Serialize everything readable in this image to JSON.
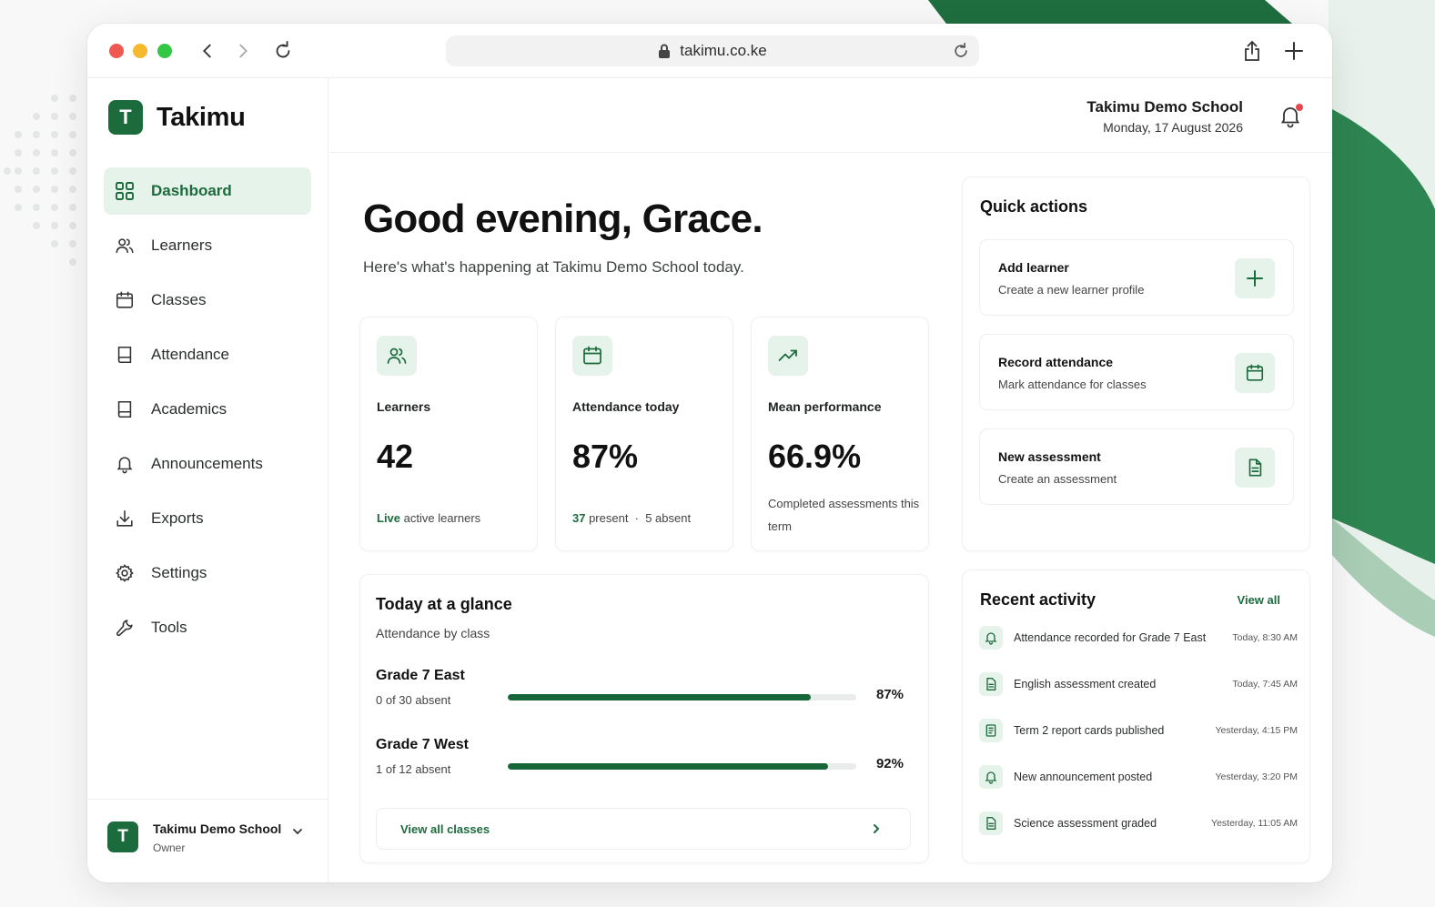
{
  "browser": {
    "url": "takimu.co.ke"
  },
  "brand": {
    "logo_letter": "T",
    "name": "Takimu",
    "accent": "#1c6b3d"
  },
  "nav": {
    "items": [
      {
        "label": "Dashboard",
        "icon": "grid-icon",
        "active": true
      },
      {
        "label": "Learners",
        "icon": "users-icon"
      },
      {
        "label": "Classes",
        "icon": "calendar-icon"
      },
      {
        "label": "Attendance",
        "icon": "book-icon"
      },
      {
        "label": "Academics",
        "icon": "book-icon"
      },
      {
        "label": "Announcements",
        "icon": "bell-icon"
      },
      {
        "label": "Exports",
        "icon": "download-icon"
      },
      {
        "label": "Settings",
        "icon": "gear-icon"
      },
      {
        "label": "Tools",
        "icon": "wrench-icon"
      }
    ]
  },
  "account": {
    "logo_letter": "T",
    "school": "Takimu Demo School",
    "role": "Owner"
  },
  "header": {
    "school": "Takimu Demo School",
    "date": "Monday, 17 August 2026"
  },
  "greeting": {
    "title": "Good evening, Grace.",
    "subtitle": "Here's what's happening at Takimu Demo School today."
  },
  "stats": [
    {
      "label": "Learners",
      "value": "42",
      "note_highlight": "Live",
      "note_rest": " active learners",
      "icon": "users-icon"
    },
    {
      "label": "Attendance today",
      "value": "87%",
      "note_highlight": "37",
      "note_rest": " present  ·  5 absent",
      "icon": "calendar-icon"
    },
    {
      "label": "Mean performance",
      "value": "66.9%",
      "note_highlight": "",
      "note_rest": "Completed assessments this term",
      "icon": "trend-up-icon"
    }
  ],
  "glance": {
    "title": "Today at a glance",
    "subtitle": "Attendance by class",
    "classes": [
      {
        "name": "Grade 7 East",
        "absent": "0 of 30 absent",
        "percent_label": "87%",
        "percent": 87
      },
      {
        "name": "Grade 7 West",
        "absent": "1 of 12 absent",
        "percent_label": "92%",
        "percent": 92
      }
    ],
    "view_all": "View all classes"
  },
  "quick_actions": {
    "title": "Quick actions",
    "items": [
      {
        "title": "Add learner",
        "subtitle": "Create a new learner profile",
        "icon": "plus-icon"
      },
      {
        "title": "Record attendance",
        "subtitle": "Mark attendance for classes",
        "icon": "calendar-icon"
      },
      {
        "title": "New assessment",
        "subtitle": "Create an assessment",
        "icon": "document-icon"
      }
    ]
  },
  "recent": {
    "title": "Recent activity",
    "view_all": "View all",
    "items": [
      {
        "text": "Attendance recorded for Grade 7 East",
        "time": "Today, 8:30 AM",
        "icon": "bell-icon"
      },
      {
        "text": "English assessment created",
        "time": "Today, 7:45 AM",
        "icon": "document-icon"
      },
      {
        "text": "Term 2 report cards published",
        "time": "Yesterday, 4:15 PM",
        "icon": "report-icon"
      },
      {
        "text": "New announcement posted",
        "time": "Yesterday, 3:20 PM",
        "icon": "bell-icon"
      },
      {
        "text": "Science assessment graded",
        "time": "Yesterday, 11:05 AM",
        "icon": "document-icon"
      }
    ]
  }
}
